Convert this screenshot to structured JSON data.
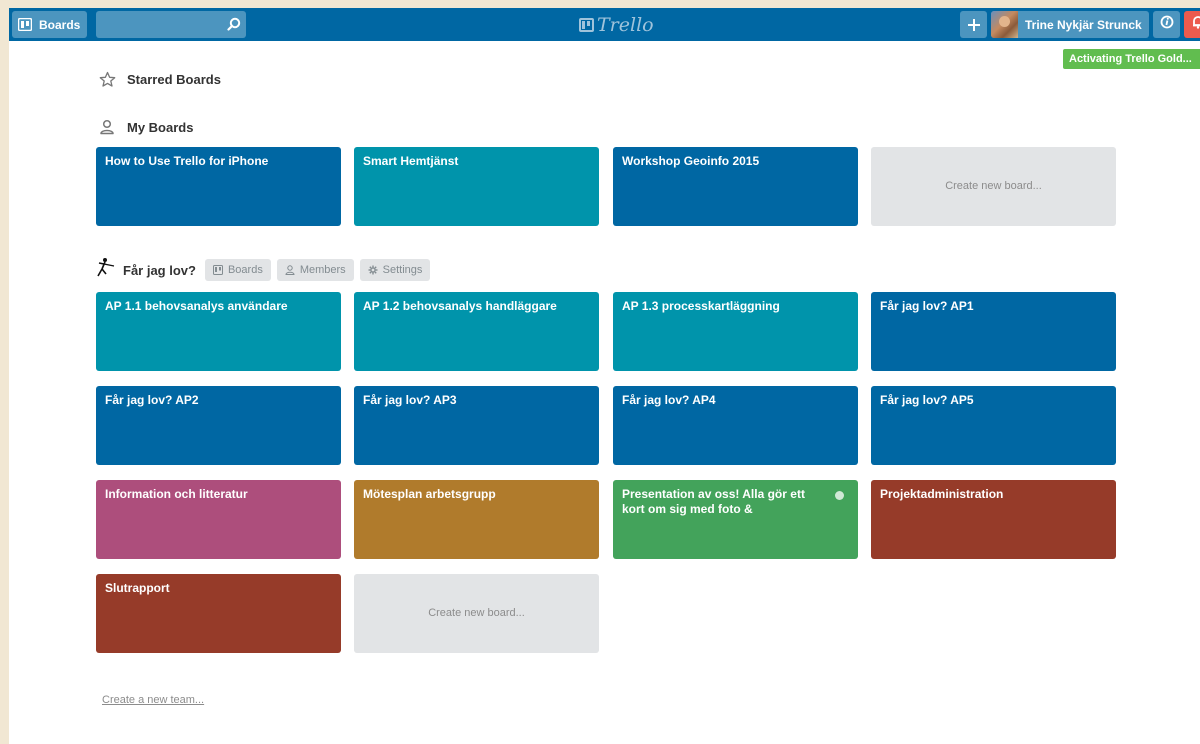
{
  "header": {
    "boards_label": "Boards",
    "logo_text": "Trello",
    "user_name": "Trine Nykjär Strunck",
    "gold_banner": "Activating Trello Gold..."
  },
  "starred": {
    "title": "Starred Boards"
  },
  "my_boards": {
    "title": "My Boards",
    "boards": [
      {
        "label": "How to Use Trello for iPhone",
        "color": "#0067a3"
      },
      {
        "label": "Smart Hemtjänst",
        "color": "#0094ab"
      },
      {
        "label": "Workshop Geoinfo 2015",
        "color": "#0067a3"
      }
    ],
    "create_label": "Create new board..."
  },
  "team": {
    "name": "Får jag lov?",
    "tabs": [
      "Boards",
      "Members",
      "Settings"
    ],
    "boards": [
      {
        "label": "AP 1.1 behovsanalys användare",
        "color": "#0094ab"
      },
      {
        "label": "AP 1.2 behovsanalys handläggare",
        "color": "#0094ab"
      },
      {
        "label": "AP 1.3 processkartläggning",
        "color": "#0094ab"
      },
      {
        "label": "Får jag lov? AP1",
        "color": "#0067a3"
      },
      {
        "label": "Får jag lov? AP2",
        "color": "#0067a3"
      },
      {
        "label": "Får jag lov? AP3",
        "color": "#0067a3"
      },
      {
        "label": "Får jag lov? AP4",
        "color": "#0067a3"
      },
      {
        "label": "Får jag lov? AP5",
        "color": "#0067a3"
      },
      {
        "label": "Information och litteratur",
        "color": "#ad4e7c"
      },
      {
        "label": "Mötesplan arbetsgrupp",
        "color": "#b07b2c"
      },
      {
        "label": "Presentation av oss! Alla gör ett kort om sig med foto &",
        "color": "#43a35b",
        "unread": true
      },
      {
        "label": "Projektadministration",
        "color": "#963b29"
      },
      {
        "label": "Slutrapport",
        "color": "#963b29"
      }
    ],
    "create_label": "Create new board..."
  },
  "footer": {
    "create_team": "Create a new team..."
  }
}
